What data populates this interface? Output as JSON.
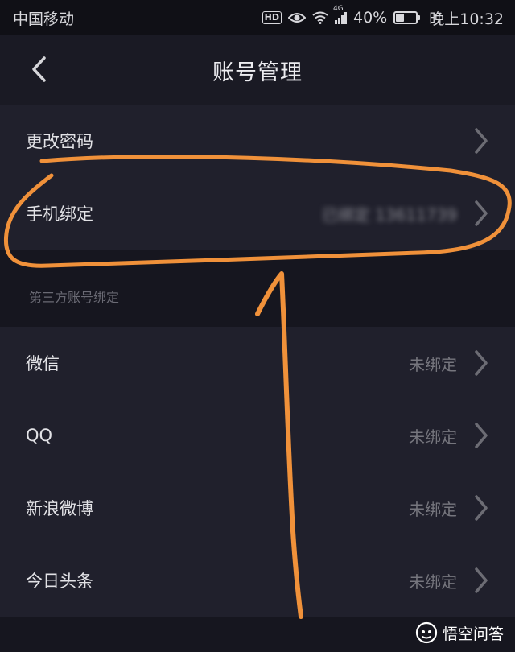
{
  "status_bar": {
    "carrier": "中国移动",
    "hd": "HD",
    "network": "4G",
    "battery_text": "40%",
    "battery_level": 0.4,
    "time": "晚上10:32"
  },
  "nav": {
    "title": "账号管理"
  },
  "account": {
    "items": [
      {
        "label": "更改密码",
        "value": ""
      },
      {
        "label": "手机绑定",
        "value": "已绑定 13611739"
      }
    ]
  },
  "third_party": {
    "header": "第三方账号绑定",
    "items": [
      {
        "label": "微信",
        "value": "未绑定"
      },
      {
        "label": "QQ",
        "value": "未绑定"
      },
      {
        "label": "新浪微博",
        "value": "未绑定"
      },
      {
        "label": "今日头条",
        "value": "未绑定"
      }
    ]
  },
  "watermark": {
    "text": "悟空问答"
  },
  "colors": {
    "background": "#16161f",
    "row_bg": "#20202c",
    "annotation": "#f0913a"
  },
  "icons": {
    "back": "chevron-left-icon",
    "row": "chevron-right-icon",
    "watermark": "wukong-logo-icon"
  }
}
